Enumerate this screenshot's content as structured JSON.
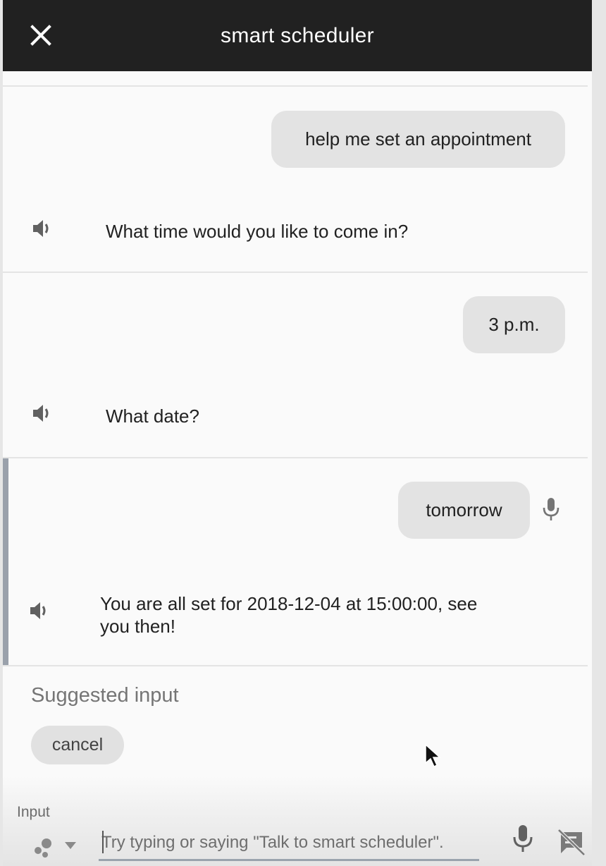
{
  "header": {
    "title": "smart scheduler",
    "close_icon": "close-icon"
  },
  "conversation": [
    {
      "role": "user",
      "text": "help me set an appointment"
    },
    {
      "role": "agent",
      "text": "What time would you like to come in?",
      "icon": "speaker-icon"
    },
    {
      "role": "user",
      "text": "3 p.m."
    },
    {
      "role": "agent",
      "text": "What date?",
      "icon": "speaker-icon"
    },
    {
      "role": "user",
      "text": "tomorrow",
      "icon": "microphone-icon"
    },
    {
      "role": "agent",
      "text": "You are all set for 2018-12-04 at 15:00:00, see you then!",
      "text_line1": "You are all set for 2018-12-04 at 15:00:00, see",
      "text_line2": "you then!",
      "icon": "speaker-icon"
    }
  ],
  "suggested": {
    "label": "Suggested input",
    "chips": [
      "cancel"
    ]
  },
  "input": {
    "label": "Input",
    "placeholder": "Try typing or saying \"Talk to smart scheduler\".",
    "value": ""
  },
  "colors": {
    "header_bg": "#212121",
    "bubble_bg": "#e3e3e3",
    "active_bar": "#9aa1ab",
    "underline": "#9aa3ad"
  }
}
